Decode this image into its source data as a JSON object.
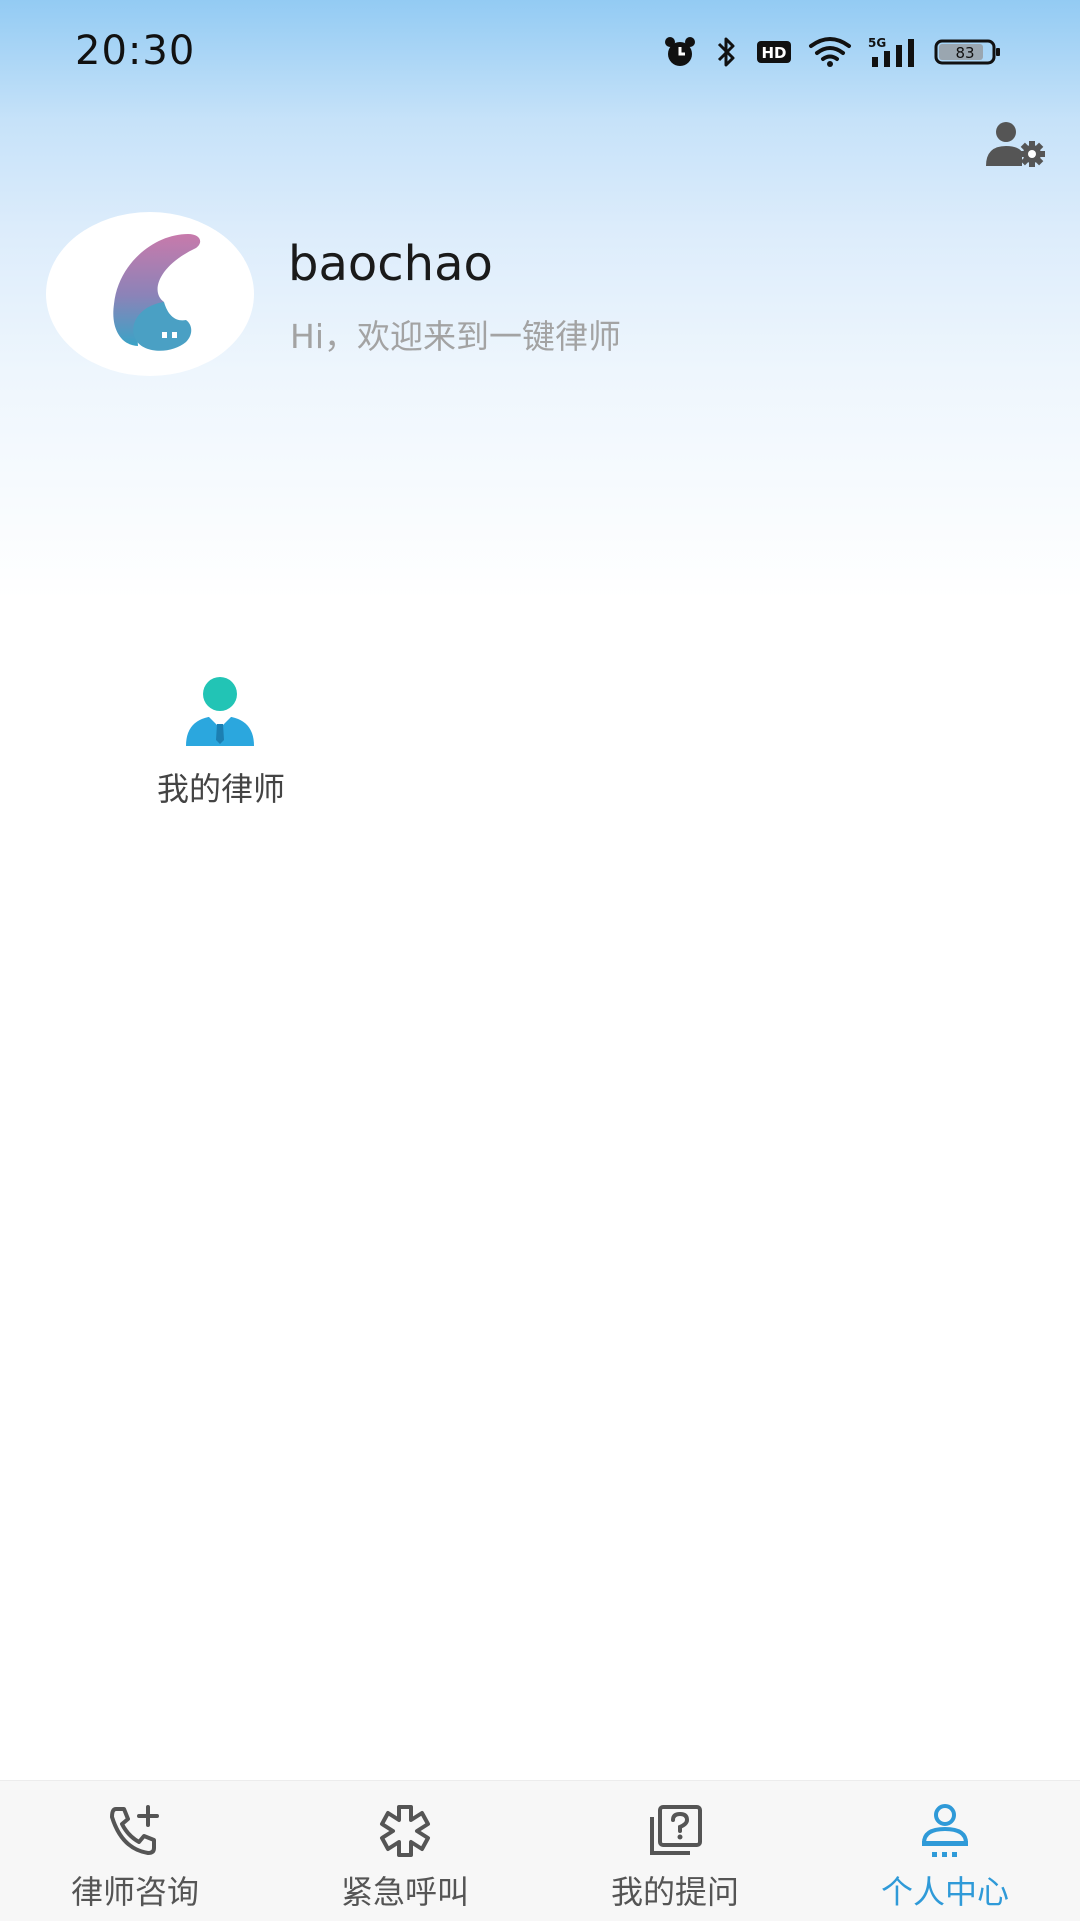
{
  "status_bar": {
    "time": "20:30",
    "hd_label": "HD",
    "network_label": "5G",
    "battery": "83"
  },
  "profile": {
    "username": "baochao",
    "greeting": "Hi，欢迎来到一键律师"
  },
  "shortcuts": [
    {
      "label": "我的律师",
      "icon": "lawyer-icon"
    }
  ],
  "bottom_nav": {
    "active_index": 3,
    "active_color": "#2f9ad8",
    "items": [
      {
        "label": "律师咨询",
        "icon": "phone-plus-icon"
      },
      {
        "label": "紧急呼叫",
        "icon": "asterisk-icon"
      },
      {
        "label": "我的提问",
        "icon": "question-stack-icon"
      },
      {
        "label": "个人中心",
        "icon": "person-center-icon"
      }
    ]
  },
  "colors": {
    "header_gradient_top": "#93cbf3",
    "accent": "#2f9ad8",
    "greeting_text": "#a3a3a3"
  }
}
